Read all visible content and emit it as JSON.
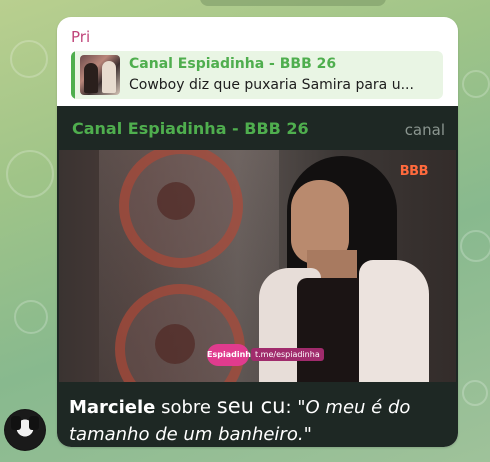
{
  "message": {
    "sender": "Pri",
    "reply": {
      "channel": "Canal Espiadinha - BBB 26",
      "text": "Cowboy diz que puxaria Samira para u..."
    },
    "media": {
      "channel": "Canal Espiadinha - BBB 26",
      "badge": "canal",
      "video_logo": "BBB",
      "watermark_logo": "Espiadinha",
      "watermark_url": "t.me/espiadinha"
    },
    "caption": {
      "name": "Marciele",
      "word_sobre": "sobre",
      "topic": "seu cu",
      "colon": ":",
      "quote": "\"O meu é do tamanho de um banheiro.\""
    }
  },
  "colors": {
    "sender": "#c0457a",
    "channel": "#4fae4e",
    "media_bg": "#1e2824",
    "chat_bg": "#9fc488"
  }
}
